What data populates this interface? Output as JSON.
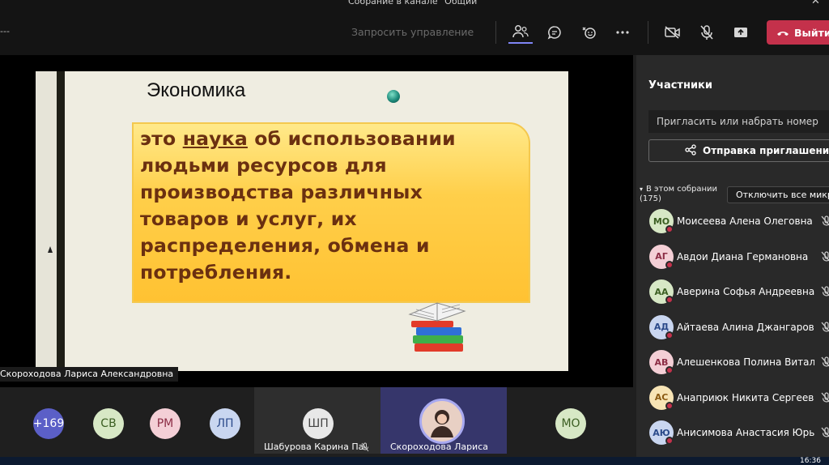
{
  "titlebar": {
    "title": "Собрание в канале \"Общий\""
  },
  "toolbar": {
    "dash": "---",
    "request_control": "Запросить управление",
    "leave_label": "Выйти",
    "icons": [
      "participants-icon",
      "chat-icon",
      "reactions-icon",
      "more-icon",
      "camera-off-icon",
      "mic-off-icon",
      "share-icon",
      "phone-icon"
    ]
  },
  "slide": {
    "title": "Экономика",
    "definition": {
      "line1_prefix": "это ",
      "line1_underlined": "наука",
      "line1_suffix": " об использовании",
      "line2": "людьми ресурсов для",
      "line3": "производства различных",
      "line4": "товаров и услуг, их",
      "line5": "распределения, обмена и",
      "line6": "потребления."
    },
    "presenter_label": "Скороходова Лариса Александровна"
  },
  "panel": {
    "title": "Участники",
    "invite_placeholder": "Пригласить или набрать номер",
    "share_invite": "Отправка приглашения",
    "section_title": "В этом собрании",
    "section_count": "(175)",
    "mute_all": "Отключить все микро...",
    "participants": [
      {
        "initials": "МО",
        "name": "Моисеева Алена Олеговна",
        "bg": "#d7e8c5",
        "fg": "#3b5e22"
      },
      {
        "initials": "АГ",
        "name": "Авдои Диана Германовна",
        "bg": "#f4cfd6",
        "fg": "#8c2d45"
      },
      {
        "initials": "АА",
        "name": "Аверина Софья Андреевна",
        "bg": "#d7e8c5",
        "fg": "#3b5e22"
      },
      {
        "initials": "АД",
        "name": "Айтаева Алина Джангаровна",
        "bg": "#c9d6f0",
        "fg": "#2b4a8a"
      },
      {
        "initials": "АВ",
        "name": "Алешенкова Полина Виталь...",
        "bg": "#f4cfd6",
        "fg": "#8c2d45"
      },
      {
        "initials": "АС",
        "name": "Анаприюк Никита Сергеевич",
        "bg": "#f7e4b5",
        "fg": "#8a5a12"
      },
      {
        "initials": "АЮ",
        "name": "Анисимова Анастасия Юрье...",
        "bg": "#c9d6f0",
        "fg": "#2b4a8a"
      }
    ]
  },
  "strip": {
    "tiles": [
      {
        "label": "+169",
        "bg": "#5b5fc7",
        "fg": "#ffffff",
        "name": ""
      },
      {
        "label": "СВ",
        "bg": "#d7e8c5",
        "fg": "#3b5e22",
        "name": ""
      },
      {
        "label": "РМ",
        "bg": "#f4cfd6",
        "fg": "#8c2d45",
        "name": ""
      },
      {
        "label": "ЛП",
        "bg": "#c9d6f0",
        "fg": "#2b4a8a",
        "name": ""
      },
      {
        "label": "ШП",
        "bg": "#e8e8e8",
        "fg": "#444444",
        "name": "Шабурова Карина Па..."
      },
      {
        "label": "",
        "bg": "#e8d0c4",
        "fg": "#333333",
        "name": "Скороходова Лариса Але..."
      },
      {
        "label": "МО",
        "bg": "#d7e8c5",
        "fg": "#3b5e22",
        "name": ""
      }
    ]
  },
  "taskbar": {
    "time": "16:36"
  },
  "colors": {
    "accent": "#7f85f5",
    "leave": "#c4314b",
    "slide_text": "#6b3010"
  }
}
